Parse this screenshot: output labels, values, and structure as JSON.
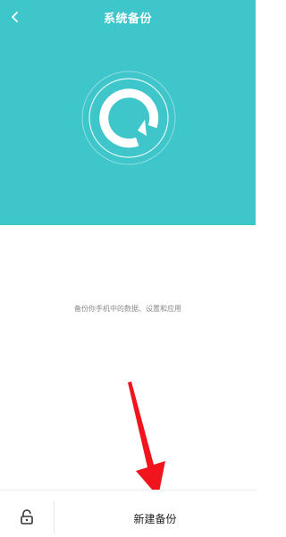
{
  "header": {
    "title": "系统备份",
    "back_icon": "chevron-left-icon",
    "background_color": "#3ec6cb"
  },
  "main": {
    "description": "备份你手机中的数据、设置和应用"
  },
  "bottom_bar": {
    "lock_icon": "unlock-icon",
    "new_backup_label": "新建备份"
  },
  "annotation": {
    "arrow_color": "#f0151d"
  }
}
